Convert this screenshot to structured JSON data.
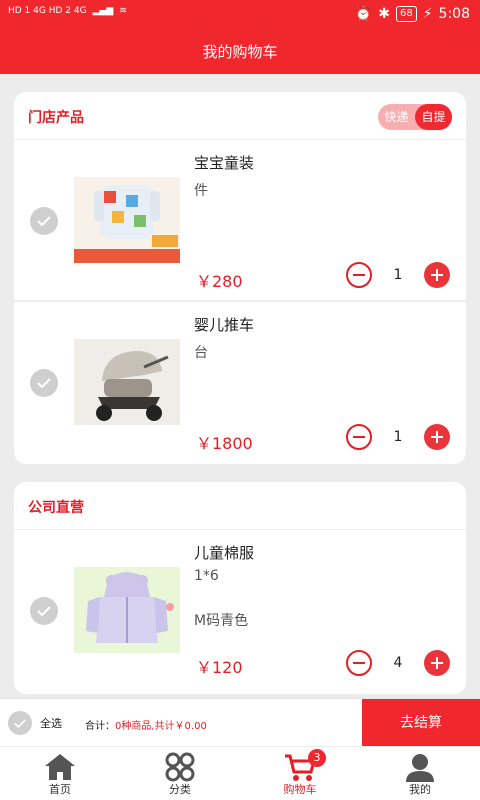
{
  "status_bar": {
    "network_left": "HD 1  4G  HD 2  4G",
    "battery": "68",
    "time": "5:08"
  },
  "header": {
    "title": "我的购物车"
  },
  "stores": [
    {
      "title": "门店产品",
      "toggle": {
        "left": "快递",
        "right": "自提",
        "selected": "自提"
      },
      "items": [
        {
          "name": "宝宝童装",
          "spec": "件",
          "extra": "",
          "price": "￥280",
          "qty": "1",
          "image": "baby-clothes-image"
        },
        {
          "name": "婴儿推车",
          "spec": "台",
          "extra": "",
          "price": "￥1800",
          "qty": "1",
          "image": "stroller-image"
        }
      ]
    },
    {
      "title": "公司直营",
      "items": [
        {
          "name": "儿童棉服",
          "spec": "1*6",
          "extra": "M码青色",
          "price": "￥120",
          "qty": "4",
          "image": "kids-coat-image"
        }
      ]
    }
  ],
  "checkout": {
    "select_all": "全选",
    "total_prefix": "合计：",
    "total_value": "0种商品,共计￥0.00",
    "button": "去结算"
  },
  "tabbar": {
    "tabs": [
      {
        "label": "首页",
        "icon": "home-icon"
      },
      {
        "label": "分类",
        "icon": "category-icon"
      },
      {
        "label": "购物车",
        "icon": "cart-icon",
        "badge": "3",
        "active": true
      },
      {
        "label": "我的",
        "icon": "profile-icon"
      }
    ]
  },
  "colors": {
    "primary": "#f0282d",
    "price": "#e31e24",
    "background": "#ececec"
  }
}
